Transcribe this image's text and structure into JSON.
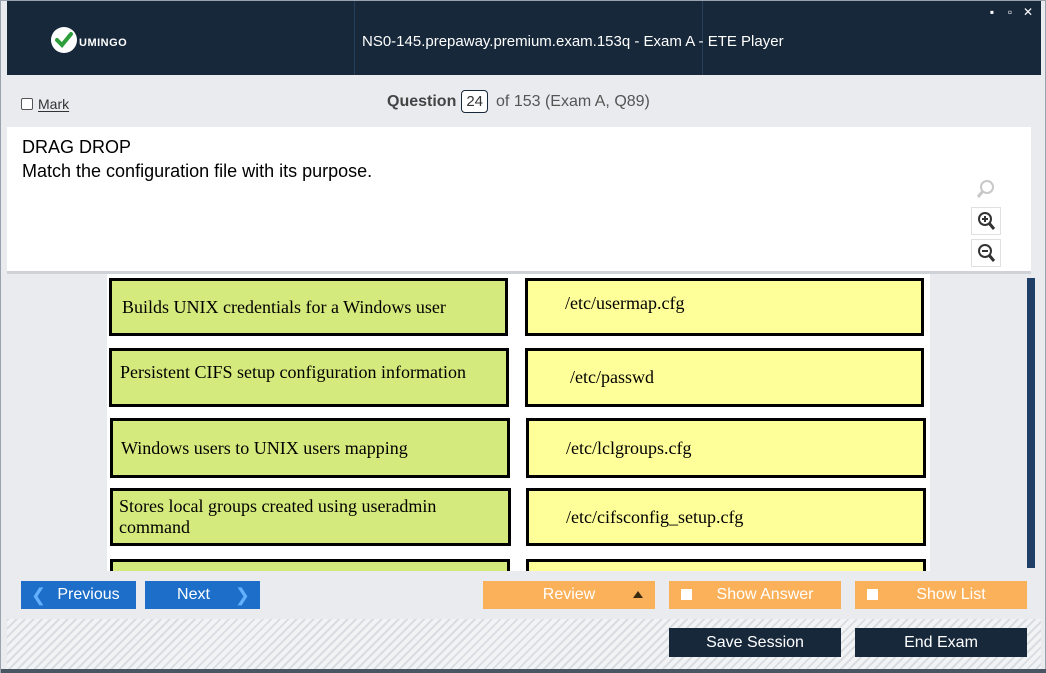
{
  "window": {
    "title": "NS0-145.prepaway.premium.exam.153q - Exam A - ETE Player",
    "logo_text": "UMINGO",
    "controls": [
      "▪",
      "▫",
      "✕"
    ]
  },
  "header": {
    "mark_label": "Mark",
    "question_label": "Question",
    "question_number": "24",
    "question_of": "of 153 (Exam A, Q89)"
  },
  "question": {
    "type": "DRAG DROP",
    "text": "Match the configuration file with its purpose."
  },
  "exhibit": {
    "rows": [
      {
        "purpose": "Builds UNIX credentials for a Windows user",
        "file": "/etc/usermap.cfg"
      },
      {
        "purpose": "Persistent CIFS setup configuration information",
        "file": "/etc/passwd"
      },
      {
        "purpose": "Windows users to UNIX users mapping",
        "file": "/etc/lclgroups.cfg"
      },
      {
        "purpose": "Stores local groups created using useradmin command",
        "file": "/etc/cifsconfig_setup.cfg"
      },
      {
        "purpose": "",
        "file": ""
      }
    ]
  },
  "nav": {
    "previous": "Previous",
    "next": "Next",
    "review": "Review",
    "show_answer": "Show Answer",
    "show_list": "Show List"
  },
  "footer": {
    "save_session": "Save Session",
    "end_exam": "End Exam"
  },
  "colors": {
    "titlebar": "#17283a",
    "accent_blue": "#1c6ec9",
    "accent_orange": "#fbb15a",
    "answer_green": "#d4ea7c",
    "answer_yellow": "#ffff99"
  }
}
